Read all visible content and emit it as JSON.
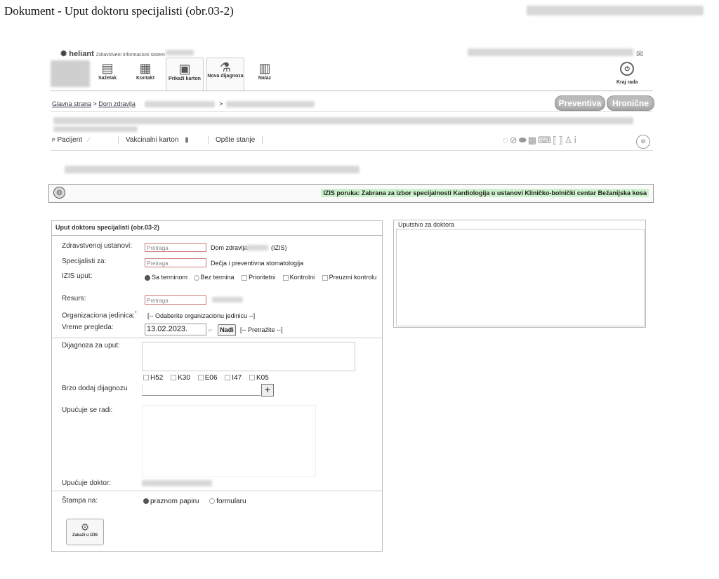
{
  "window": {
    "title": "Dokument - Uput doktoru specijalisti (obr.03-2)"
  },
  "header": {
    "logo_text": "heliant",
    "logo_subtitle": "Zdravstveni informacioni sistem",
    "nav": [
      {
        "label": "Sažetak",
        "icon": "summary-icon"
      },
      {
        "label": "Kontakt",
        "icon": "contact-icon"
      },
      {
        "label": "Prikaži karton",
        "icon": "record-icon"
      },
      {
        "label": "Nova dijagnoza",
        "icon": "diagnosis-icon"
      },
      {
        "label": "Nalaz",
        "icon": "report-icon"
      }
    ],
    "logout_label": "Kraj rada"
  },
  "breadcrumb": {
    "home": "Glavna strana",
    "sep": ">",
    "second": "Dom zdravlja",
    "sep2": ">"
  },
  "actions": {
    "preventiva": "Preventiva",
    "hronicne": "Hronične"
  },
  "tabs": {
    "pacijent": "Pacijent",
    "vakcinalni": "Vakcinalni karton",
    "opste": "Opšte stanje"
  },
  "alert": {
    "message": "IZIS poruka: Zabrana za izbor specijalnosti Kardiologija u ustanovi Kliničko-bolnički centar Bežanijska kosa"
  },
  "form": {
    "title": "Uput doktoru specijalisti (obr.03-2)",
    "search_placeholder": "Pretraga",
    "fields": {
      "ustanova_label": "Zdravstvenoj ustanovi:",
      "ustanova_value_prefix": "Dom zdravlja",
      "ustanova_value_suffix": "(IZIS)",
      "specijalisti_label": "Specijalisti za:",
      "specijalisti_value": "Dečja i preventivna stomatologija",
      "izis_label": "IZIS uput:",
      "izis_options": [
        "Sa terminom",
        "Bez termina",
        "Prioritetni",
        "Kontrolni",
        "Preuzmi kontrolu"
      ],
      "resurs_label": "Resurs:",
      "org_label": "Organizaciona jedinica:",
      "org_required": "*",
      "org_value": "[-- Odaberite organizacionu jedinicu --]",
      "vreme_label": "Vreme pregleda:",
      "vreme_value": "13.02.2023.",
      "nadji_label": "Nađi",
      "pretrazite_value": "[-- Pretražite --]",
      "dijagnoza_label": "Dijagnoza za uput:",
      "diag_codes": [
        "H52",
        "K30",
        "E06",
        "I47",
        "K05"
      ],
      "brzo_label": "Brzo dodaj dijagnozu",
      "upucuje_radi_label": "Upućuje se radi:",
      "upucuje_doktor_label": "Upućuje doktor:",
      "stampa_label": "Štampa na:",
      "stampa_options": [
        "praznom papiru",
        "formularu"
      ]
    },
    "zakazi_label": "Zakaži u IZIS"
  },
  "guide": {
    "title": "Uputstvo za doktora"
  }
}
